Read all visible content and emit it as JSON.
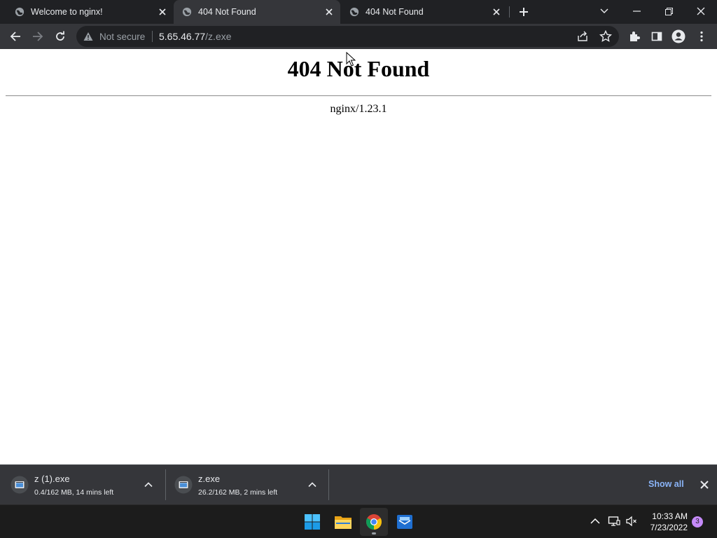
{
  "tabs": [
    {
      "title": "Welcome to nginx!",
      "active": false
    },
    {
      "title": "404 Not Found",
      "active": true
    },
    {
      "title": "404 Not Found",
      "active": false
    }
  ],
  "omnibox": {
    "security_label": "Not secure",
    "url_host": "5.65.46.77",
    "url_path": "/z.exe"
  },
  "page": {
    "heading": "404 Not Found",
    "server": "nginx/1.23.1"
  },
  "downloads": [
    {
      "filename": "z (1).exe",
      "status": "0.4/162 MB, 14 mins left"
    },
    {
      "filename": "z.exe",
      "status": "26.2/162 MB, 2 mins left"
    }
  ],
  "shelf": {
    "show_all_label": "Show all"
  },
  "taskbar": {
    "apps": [
      "windows-start",
      "file-explorer",
      "chrome",
      "mail"
    ],
    "time": "10:33 AM",
    "date": "7/23/2022",
    "notification_count": "3"
  },
  "colors": {
    "accent_link": "#8ab4f8",
    "frame_dark": "#202124",
    "toolbar": "#35363a"
  }
}
